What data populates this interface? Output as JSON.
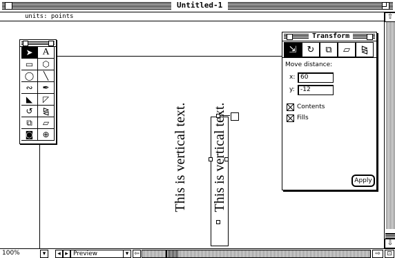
{
  "window": {
    "title": "Untitled-1",
    "units_label": "units: points"
  },
  "canvas": {
    "text_objects": [
      {
        "text": "This is vertical text."
      },
      {
        "text": "This is vertical text."
      }
    ]
  },
  "toolbox": {
    "tools": [
      {
        "name": "selection-arrow-tool",
        "glyph": "➤"
      },
      {
        "name": "text-tool",
        "glyph": "A"
      },
      {
        "name": "rectangle-tool",
        "glyph": "▭"
      },
      {
        "name": "polygon-tool",
        "glyph": "⬡"
      },
      {
        "name": "ellipse-tool",
        "glyph": "◯"
      },
      {
        "name": "line-tool",
        "glyph": "╲"
      },
      {
        "name": "freehand-tool",
        "glyph": "∾"
      },
      {
        "name": "pen-tool",
        "glyph": "✒"
      },
      {
        "name": "knife-tool",
        "glyph": "◣"
      },
      {
        "name": "bezigon-tool",
        "glyph": "◸"
      },
      {
        "name": "rotate-tool",
        "glyph": "↺"
      },
      {
        "name": "reflect-tool",
        "glyph": "⧎"
      },
      {
        "name": "scale-tool",
        "glyph": "⧉"
      },
      {
        "name": "skew-tool",
        "glyph": "▱"
      },
      {
        "name": "trace-tool",
        "glyph": "◙"
      },
      {
        "name": "zoom-tool",
        "glyph": "⊕"
      }
    ]
  },
  "transform_palette": {
    "title": "Transform",
    "tabs": [
      {
        "name": "move",
        "glyph": "⇲"
      },
      {
        "name": "rotate",
        "glyph": "↻"
      },
      {
        "name": "scale",
        "glyph": "⧉"
      },
      {
        "name": "skew",
        "glyph": "▱"
      },
      {
        "name": "reflect",
        "glyph": "⧎"
      }
    ],
    "move_distance_label": "Move distance:",
    "x_label": "x:",
    "x_value": "60",
    "y_label": "y:",
    "y_value": "-12",
    "contents_label": "Contents",
    "fills_label": "Fills",
    "apply_label": "Apply"
  },
  "statusbar": {
    "zoom": "100%",
    "view_mode": "Preview"
  }
}
